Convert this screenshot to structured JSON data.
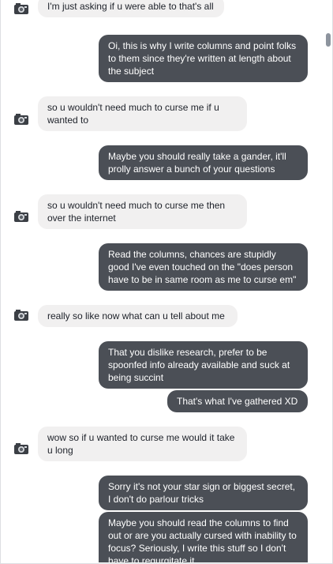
{
  "messages": [
    {
      "side": "in",
      "text": "I'm just asking if u were able to that's all"
    },
    {
      "side": "out",
      "text": "Oi, this is why I write columns and point folks to them since they're written at length about the subject"
    },
    {
      "side": "in",
      "text": "so u wouldn't need much to curse me if u wanted to"
    },
    {
      "side": "out",
      "text": "Maybe you should really take a gander, it'll prolly answer a bunch of your questions"
    },
    {
      "side": "in",
      "text": "so u wouldn't need much to curse me then over the internet"
    },
    {
      "side": "out",
      "text": "Read the columns, chances are stupidly good I've even touched on the \"does person have to be in same room as me to curse em\""
    },
    {
      "side": "in",
      "text": "really so like now what can u tell about me"
    },
    {
      "side": "out",
      "text": "That you dislike research, prefer to be spoonfed info already available and suck at being succint"
    },
    {
      "side": "out",
      "text": "That's what I've gathered XD"
    },
    {
      "side": "in",
      "text": "wow so if u wanted to curse me would it take u long"
    },
    {
      "side": "out",
      "text": "Sorry it's not your star sign or biggest secret, I don't do parlour tricks"
    },
    {
      "side": "out",
      "text": "Maybe you should read the columns to find out or are you actually cursed with inability to focus? Seriously, I write this stuff so I don't have to regurgitate it"
    }
  ],
  "colors": {
    "incoming_bg": "#f1f0f0",
    "outgoing_bg": "#4b4f56",
    "incoming_text": "#1d2129",
    "outgoing_text": "#ffffff"
  },
  "icons": {
    "avatar": "contact-avatar-icon"
  }
}
